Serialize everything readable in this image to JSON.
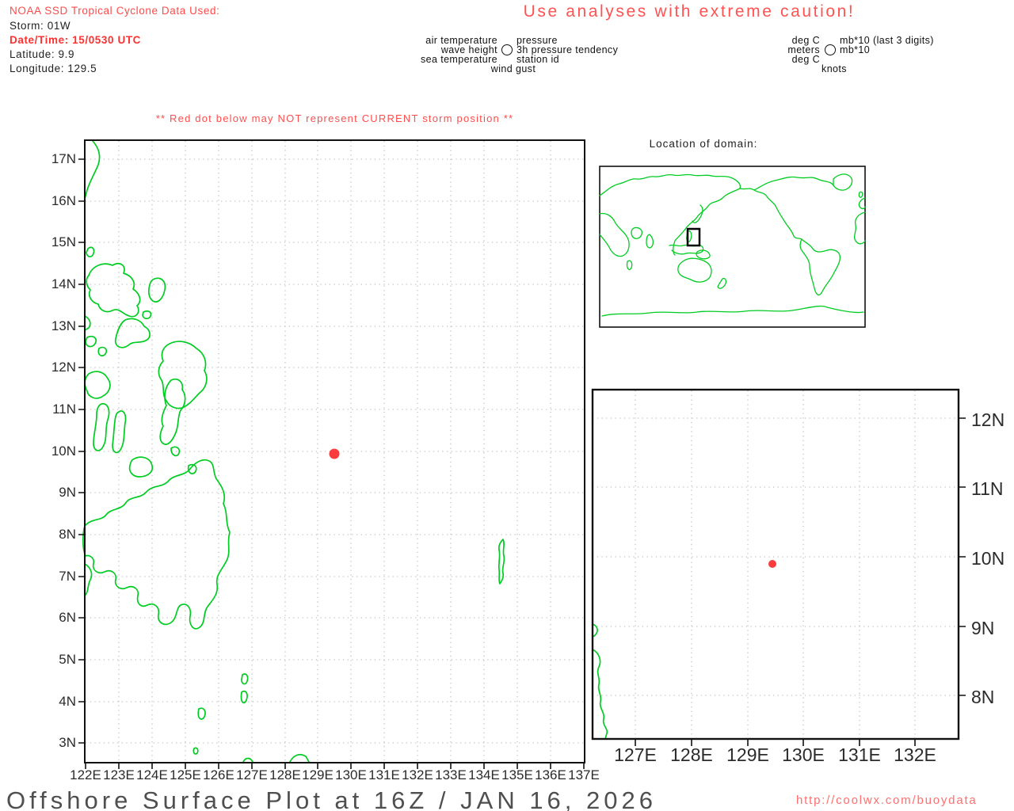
{
  "header": {
    "source": "NOAA SSD Tropical Cyclone Data Used:",
    "storm": "Storm: 01W",
    "datetime": "Date/Time: 15/0530 UTC",
    "latitude": "Latitude: 9.9",
    "longitude": "Longitude: 129.5",
    "caution": "Use analyses with extreme caution!"
  },
  "storm": {
    "id": "01W",
    "datetime_utc": "15/0530 UTC",
    "latitude": 9.9,
    "longitude": 129.5
  },
  "legend": {
    "left": [
      "air temperature",
      "wave height",
      "sea temperature"
    ],
    "right": [
      "pressure",
      "3h pressure tendency",
      "station id"
    ],
    "bottom": "wind gust",
    "units_left": [
      "deg C",
      "meters",
      "deg C"
    ],
    "units_right": [
      "mb*10 (last 3 digits)",
      "mb*10"
    ],
    "units_bottom": "knots",
    "station_circle_icon": "station-circle"
  },
  "warning": {
    "text": "** Red dot below may NOT represent CURRENT storm position **"
  },
  "inset": {
    "title": "Location of domain:"
  },
  "main_map": {
    "lon_labels": [
      "122E",
      "123E",
      "124E",
      "125E",
      "126E",
      "127E",
      "128E",
      "129E",
      "130E",
      "131E",
      "132E",
      "133E",
      "134E",
      "135E",
      "136E",
      "137E"
    ],
    "lat_labels": [
      "17N",
      "16N",
      "15N",
      "14N",
      "13N",
      "12N",
      "11N",
      "10N",
      "9N",
      "8N",
      "7N",
      "6N",
      "5N",
      "4N",
      "3N"
    ],
    "lon_range": [
      122,
      137
    ],
    "lat_range": [
      3,
      17
    ],
    "storm_dot": {
      "lon": 129.5,
      "lat": 9.9
    }
  },
  "zoom_map": {
    "lon_labels": [
      "127E",
      "128E",
      "129E",
      "130E",
      "131E",
      "132E"
    ],
    "lat_labels": [
      "12N",
      "11N",
      "10N",
      "9N",
      "8N"
    ],
    "storm_dot": {
      "lon": 129.5,
      "lat": 9.9
    }
  },
  "footer": {
    "title": "Offshore Surface Plot at 16Z / JAN 16, 2026",
    "url": "http://coolwx.com/buoydata"
  },
  "colors": {
    "coastline_green": "#00cc22",
    "storm_dot_red": "#fa3c3c",
    "warning_red": "#ff4d4d",
    "grid_gray": "#c3c3c3",
    "axis_text": "#2b2b2b",
    "title_gray": "#4f4f4f",
    "url_red": "#ff6e6e"
  }
}
